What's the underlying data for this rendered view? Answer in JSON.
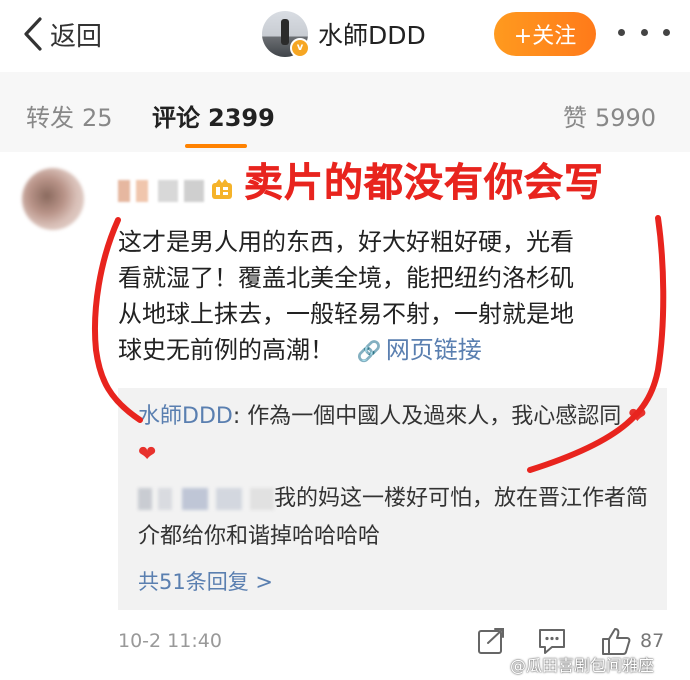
{
  "topbar": {
    "back_label": "返回",
    "author_name": "水師DDD",
    "follow_label": "+关注",
    "verified_badge": "v"
  },
  "tabs": {
    "repost": {
      "label": "转发",
      "count": "25"
    },
    "comment": {
      "label": "评论",
      "count": "2399"
    },
    "like": {
      "label": "赞",
      "count": "5990"
    }
  },
  "overlay_title": "卖片的都没有你会写",
  "comment": {
    "lines": [
      "这才是男人用的东西，好大好粗好硬，光看",
      "看就湿了！覆盖北美全境，能把纽约洛杉矶",
      "从地球上抹去，一般轻易不射，一射就是地",
      "球史无前例的高潮！"
    ],
    "link_text": "网页链接",
    "timestamp": "10-2 11:40",
    "likes": "87"
  },
  "replies": [
    {
      "name": "水師DDD",
      "text": ": 作為一個中國人及過來人，我心感認同",
      "hearts": "❤❤"
    },
    {
      "name_suffix": "我的妈",
      "text": "这一楼好可怕，放在晋江作者简介都给你和谐掉哈哈哈哈"
    }
  ],
  "more_replies": "共51条回复 >",
  "watermark": "@瓜田喜剧包间雅座",
  "colors": {
    "accent": "#ff8200",
    "link": "#5a7fb0",
    "annotation_red": "#e8241e"
  }
}
